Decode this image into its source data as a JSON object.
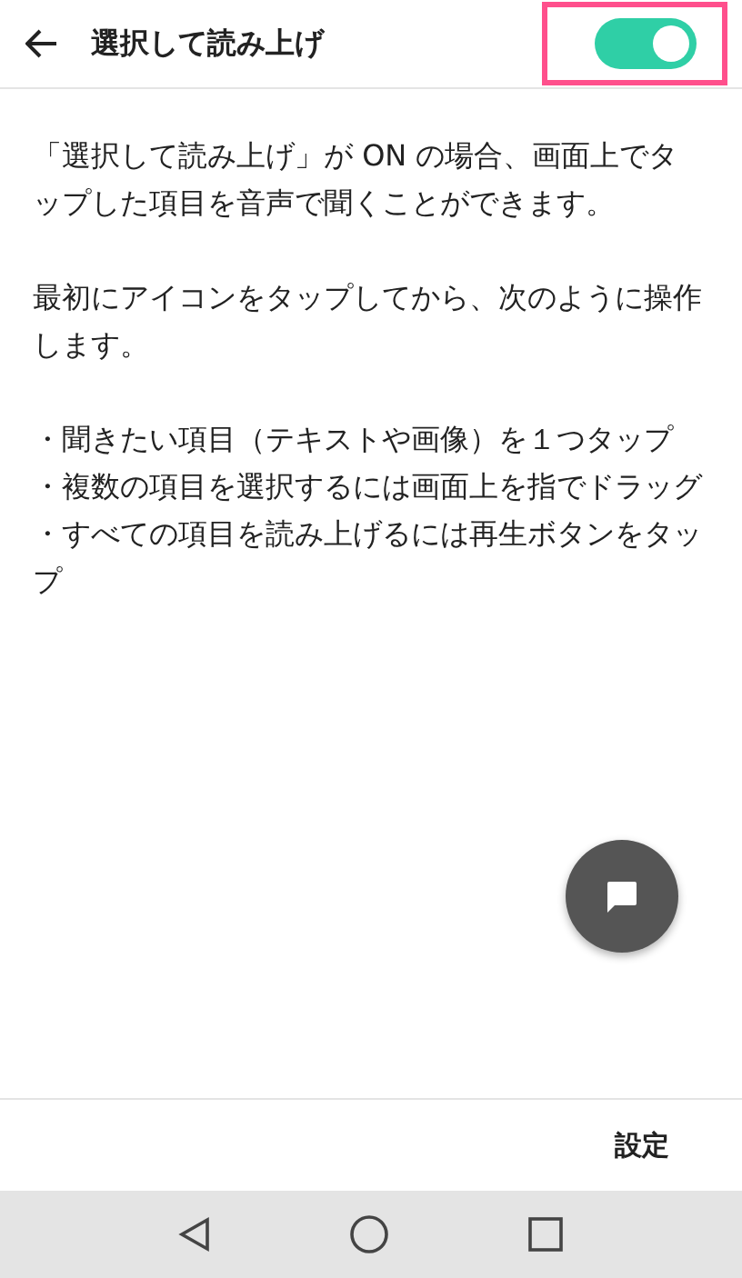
{
  "header": {
    "title": "選択して読み上げ",
    "toggle": {
      "on": true
    },
    "highlight": true
  },
  "paragraphs": [
    "「選択して読み上げ」が ON の場合、画面上でタップした項目を音声で聞くことができます。",
    "最初にアイコンをタップしてから、次のように操作します。"
  ],
  "bullets": [
    "・聞きたい項目（テキストや画像）を１つタップ",
    "・複数の項目を選択するには画面上を指でドラッグ",
    "・すべての項目を読み上げるには再生ボタンをタップ"
  ],
  "footer": {
    "button": "設定"
  }
}
